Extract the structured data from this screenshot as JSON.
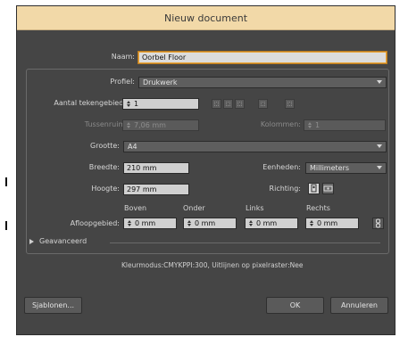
{
  "window": {
    "title": "Nieuw document"
  },
  "form": {
    "name": {
      "label": "Naam:",
      "value": "Oorbel Floor"
    },
    "profile": {
      "label": "Profiel:",
      "value": "Drukwerk"
    },
    "artboards": {
      "label": "Aantal tekengebieden:",
      "value": "1"
    },
    "spacing": {
      "label": "Tussenruimte:",
      "value": "7,06 mm"
    },
    "columns": {
      "label": "Kolommen:",
      "value": "1"
    },
    "size": {
      "label": "Grootte:",
      "value": "A4"
    },
    "width": {
      "label": "Breedte:",
      "value": "210 mm"
    },
    "units": {
      "label": "Eenheden:",
      "value": "Millimeters"
    },
    "height": {
      "label": "Hoogte:",
      "value": "297 mm"
    },
    "orientation": {
      "label": "Richting:"
    },
    "bleed": {
      "label": "Afloopgebied:",
      "top": {
        "label": "Boven",
        "value": "0 mm"
      },
      "bottom": {
        "label": "Onder",
        "value": "0 mm"
      },
      "left": {
        "label": "Links",
        "value": "0 mm"
      },
      "right": {
        "label": "Rechts",
        "value": "0 mm"
      }
    },
    "advanced": {
      "label": "Geavanceerd"
    },
    "info": "Kleurmodus:CMYKPPI:300, Uitlijnen op pixelraster:Nee"
  },
  "buttons": {
    "templates": "Sjablonen...",
    "ok": "OK",
    "cancel": "Annuleren"
  }
}
